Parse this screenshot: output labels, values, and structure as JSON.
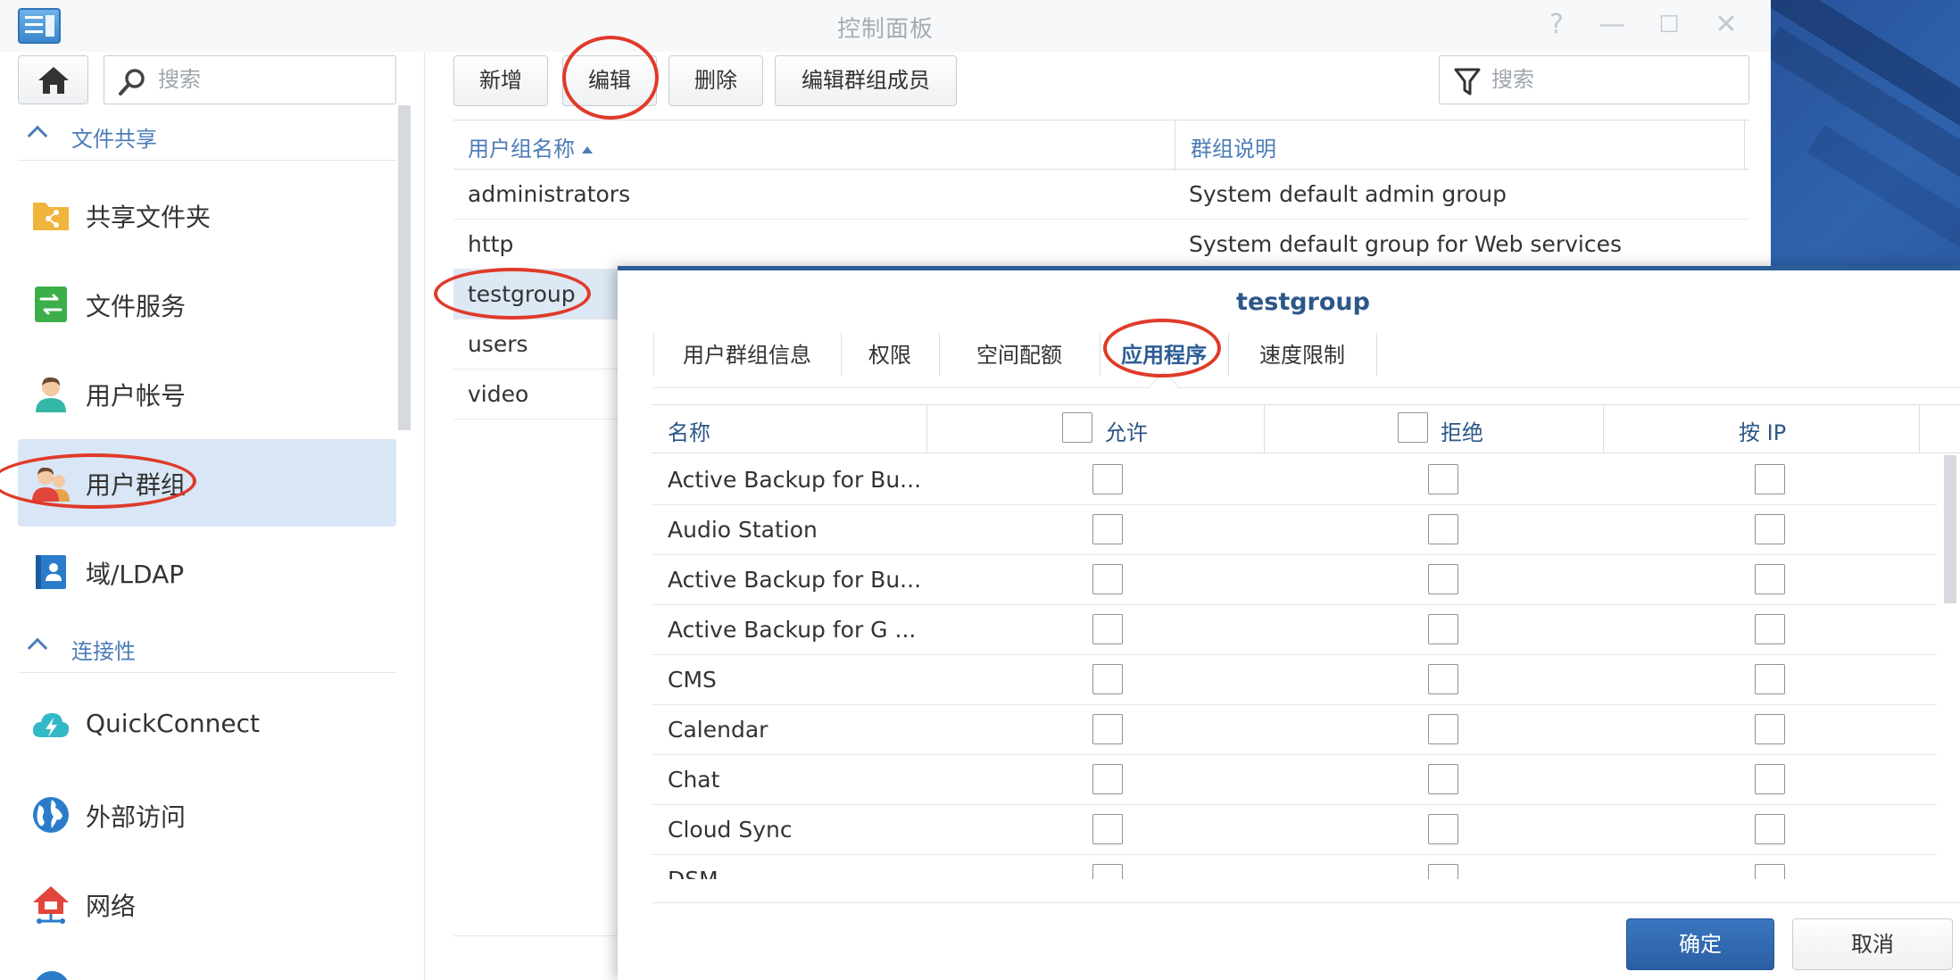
{
  "window": {
    "title": "控制面板",
    "controls": [
      "?",
      "—",
      "☐",
      "✕"
    ]
  },
  "sidebar": {
    "search_placeholder": "搜索",
    "sections": [
      {
        "label": "文件共享"
      },
      {
        "label": "连接性"
      }
    ],
    "items": [
      {
        "label": "共享文件夹",
        "icon": "shared-folder-icon"
      },
      {
        "label": "文件服务",
        "icon": "file-services-icon"
      },
      {
        "label": "用户帐号",
        "icon": "user-icon"
      },
      {
        "label": "用户群组",
        "icon": "user-group-icon",
        "selected": true
      },
      {
        "label": "域/LDAP",
        "icon": "domain-ldap-icon"
      },
      {
        "label": "QuickConnect",
        "icon": "quickconnect-icon"
      },
      {
        "label": "外部访问",
        "icon": "globe-icon"
      },
      {
        "label": "网络",
        "icon": "network-icon"
      }
    ]
  },
  "toolbar": {
    "add_label": "新增",
    "edit_label": "编辑",
    "delete_label": "删除",
    "edit_members_label": "编辑群组成员",
    "search_placeholder": "搜索"
  },
  "group_table": {
    "columns": [
      "用户组名称",
      "群组说明"
    ],
    "rows": [
      {
        "name": "administrators",
        "desc": "System default admin group"
      },
      {
        "name": "http",
        "desc": "System default group for Web services"
      },
      {
        "name": "testgroup",
        "desc": "",
        "selected": true
      },
      {
        "name": "users",
        "desc": ""
      },
      {
        "name": "video",
        "desc": ""
      }
    ]
  },
  "dialog": {
    "title": "testgroup",
    "tabs": [
      {
        "label": "用户群组信息"
      },
      {
        "label": "权限"
      },
      {
        "label": "空间配额"
      },
      {
        "label": "应用程序",
        "active": true
      },
      {
        "label": "速度限制"
      }
    ],
    "columns": [
      "名称",
      "允许",
      "拒绝",
      "按 IP"
    ],
    "apps": [
      "Active Backup for Bu...",
      "Audio Station",
      "Active Backup for Bu...",
      "Active Backup for G ...",
      "CMS",
      "Calendar",
      "Chat",
      "Cloud Sync",
      "DSM"
    ],
    "ok_label": "确定",
    "cancel_label": "取消"
  },
  "colors": {
    "accent": "#2d5d96",
    "annotation": "#e03a2a",
    "selected_row": "#d9e6f6"
  }
}
